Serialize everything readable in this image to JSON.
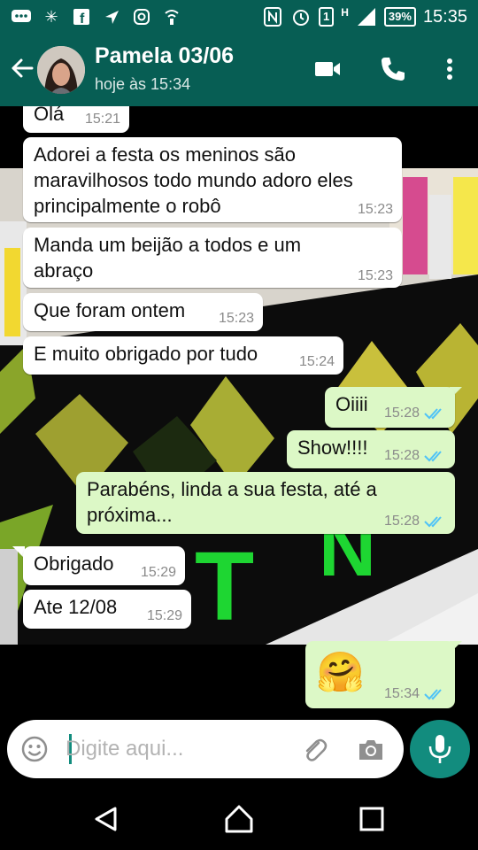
{
  "status_bar": {
    "battery": "39%",
    "sim": "1",
    "network": "H",
    "time": "15:35"
  },
  "header": {
    "name": "Pamela 03/06",
    "last_seen": "hoje às 15:34"
  },
  "messages": [
    {
      "side": "in",
      "text": "Olá",
      "time": "15:21"
    },
    {
      "side": "in",
      "text": "Adorei a festa os meninos são maravilhosos todo mundo adoro eles principalmente o robô",
      "time": "15:23"
    },
    {
      "side": "in",
      "text": "Manda um beijão a todos e um abraço",
      "time": "15:23"
    },
    {
      "side": "in",
      "text": "Que foram ontem",
      "time": "15:23"
    },
    {
      "side": "in",
      "text": "E muito obrigado por tudo",
      "time": "15:24"
    },
    {
      "side": "out",
      "text": "Oiiii",
      "time": "15:28",
      "read": true
    },
    {
      "side": "out",
      "text": "Show!!!!",
      "time": "15:28",
      "read": true
    },
    {
      "side": "out",
      "text": "Parabéns, linda a sua festa, até a próxima...",
      "time": "15:28",
      "read": true
    },
    {
      "side": "in",
      "text": "Obrigado",
      "time": "15:29"
    },
    {
      "side": "in",
      "text": "Ate 12/08",
      "time": "15:29"
    },
    {
      "side": "out",
      "text": "🤗",
      "time": "15:34",
      "read": true
    }
  ],
  "input": {
    "placeholder": "Digite aqui..."
  },
  "icons": {
    "back": "arrow-left",
    "video": "video-camera",
    "call": "phone",
    "menu": "dots-vertical",
    "emoji": "smiley",
    "attach": "paperclip",
    "camera": "camera",
    "mic": "microphone"
  },
  "colors": {
    "header": "#075e54",
    "outgoing_bubble": "#dcf8c6",
    "incoming_bubble": "#ffffff",
    "read_ticks": "#4fc3f7",
    "mic_button": "#128c7e"
  }
}
